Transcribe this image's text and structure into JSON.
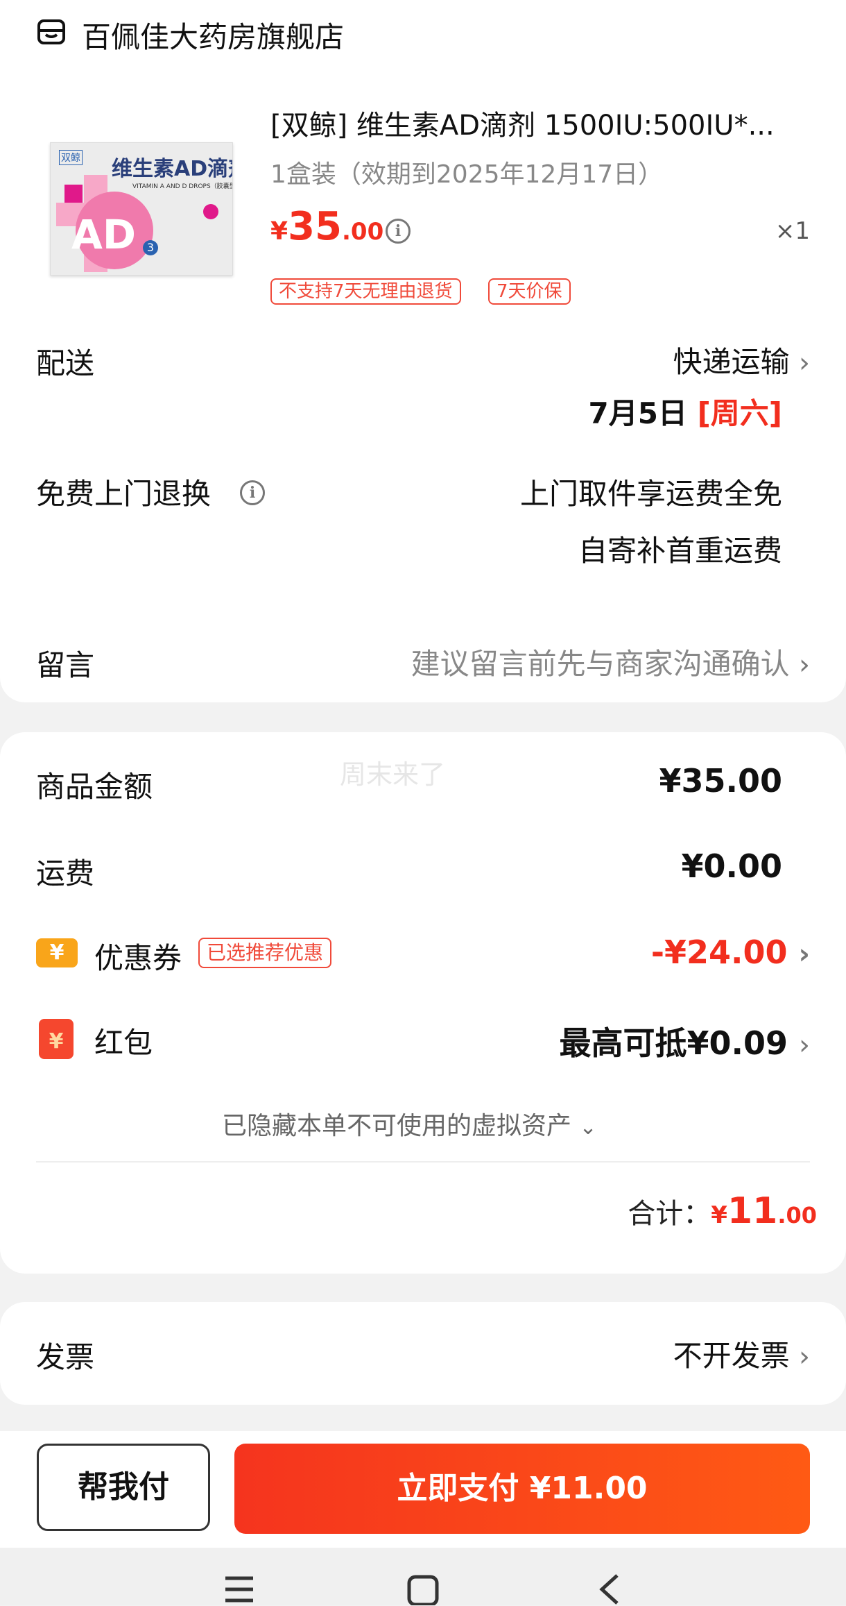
{
  "store": {
    "icon": "store-icon",
    "name": "百佩佳大药房旗舰店"
  },
  "product": {
    "image_brand": "双鲸",
    "image_title": "维生素AD滴剂",
    "image_subtitle": "VITAMIN A AND D DROPS（胶囊型）",
    "image_big": "AD",
    "image_badge": "3",
    "title": "[双鲸] 维生素AD滴剂 1500IU:500IU*...",
    "spec": "1盒装（效期到2025年12月17日）",
    "price_symbol": "¥",
    "price_int": "35",
    "price_dec": ".00",
    "quantity": "×1",
    "tags": [
      "不支持7天无理由退货",
      "7天价保"
    ]
  },
  "delivery": {
    "label": "配送",
    "method": "快递运输",
    "date": "7月5日",
    "weekday": "[周六]"
  },
  "return_service": {
    "label": "免费上门退换",
    "line1": "上门取件享运费全免",
    "line2": "自寄补首重运费"
  },
  "message": {
    "label": "留言",
    "placeholder": "建议留言前先与商家沟通确认"
  },
  "watermark": "周末来了",
  "summary": {
    "goods_label": "商品金额",
    "goods_value": "¥35.00",
    "shipping_label": "运费",
    "shipping_value": "¥0.00",
    "coupon_icon": "¥",
    "coupon_label": "优惠券",
    "coupon_tag": "已选推荐优惠",
    "coupon_value": "-¥24.00",
    "redpacket_icon": "¥",
    "redpacket_label": "红包",
    "redpacket_value": "最高可抵¥0.09",
    "hidden_assets": "已隐藏本单不可使用的虚拟资产",
    "total_label": "合计：",
    "total_symbol": "¥",
    "total_int": "11",
    "total_dec": ".00"
  },
  "invoice": {
    "label": "发票",
    "value": "不开发票"
  },
  "actions": {
    "help_pay": "帮我付",
    "pay_now": "立即支付 ¥11.00"
  },
  "nav": {
    "menu": "menu-icon",
    "home": "home-icon",
    "back": "back-icon"
  },
  "colors": {
    "accent": "#f22e1e",
    "pay_gradient_start": "#f5341e",
    "pay_gradient_end": "#ff5a14"
  }
}
